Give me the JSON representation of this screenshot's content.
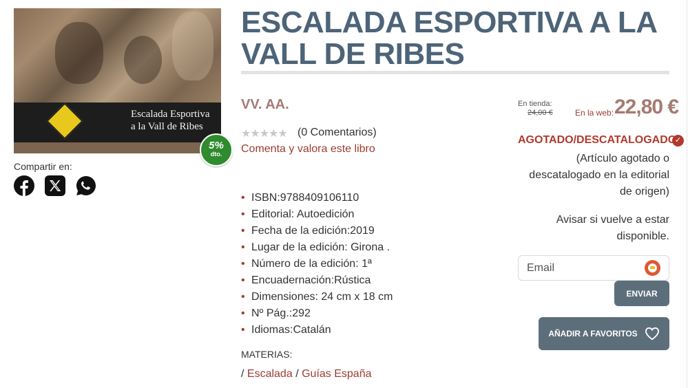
{
  "book": {
    "title": "ESCALADA ESPORTIVA A LA VALL DE RIBES",
    "cover_text_line1": "Escalada Esportiva",
    "cover_text_line2": "a la Vall de Ribes",
    "discount_pct": "5%",
    "discount_suffix": "dto.",
    "author": "VV. AA.",
    "stars_glyph": "★★★★★",
    "comments": "(0 Comentarios)",
    "rate_link": "Comenta y valora este libro"
  },
  "share": {
    "label": "Compartir en:",
    "networks": [
      "facebook-icon",
      "x-icon",
      "whatsapp-icon"
    ]
  },
  "specs": [
    "ISBN:9788409106110",
    "Editorial: Autoedición",
    "Fecha de la edición:2019",
    "Lugar de la edición: Girona .",
    "Número de la edición: 1ª",
    "Encuadernación:Rústica",
    "Dimensiones: 24 cm x 18 cm",
    "Nº Pág.:292",
    "Idiomas:Catalán"
  ],
  "materias": {
    "label": "MATERIAS:",
    "separator": "/",
    "items": [
      "Escalada",
      "Guías España"
    ]
  },
  "price": {
    "tienda_label": "En tienda:",
    "tienda_price": "24,00 €",
    "web_label": "En la web:",
    "web_price": "22,80 €"
  },
  "availability": {
    "status": "AGOTADO/DESCATALOGADO",
    "note": "(Artículo agotado o descatalogado en la editorial de origen)",
    "notify_text": "Avisar si vuelve a estar disponible.",
    "email_placeholder": "Email",
    "send_label": "ENVIAR",
    "favorites_label": "AÑADIR A FAVORITOS"
  },
  "colors": {
    "title": "#4d6478",
    "accent_red": "#9b3d32",
    "price": "#a57b72",
    "button": "#5d6e7b",
    "badge": "#2e8b2e"
  }
}
